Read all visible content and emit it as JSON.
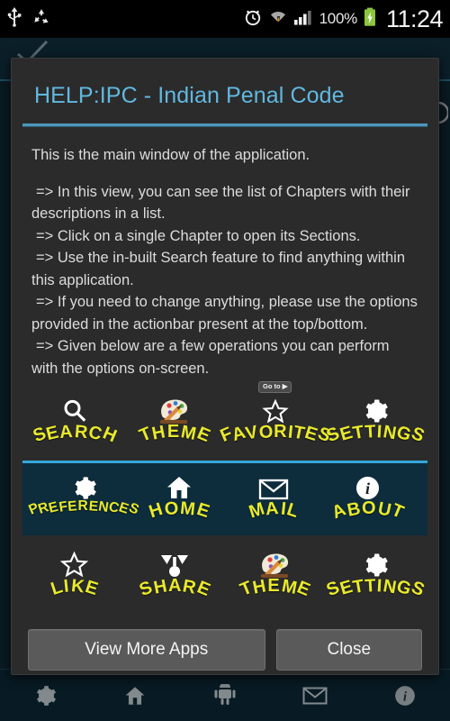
{
  "statusbar": {
    "icons": [
      "usb-icon",
      "recycle-icon",
      "alarm-clock-icon",
      "wifi-icon",
      "signal-bars-icon",
      "battery-charging-icon"
    ],
    "battery_percent": "100%",
    "clock": "11:24"
  },
  "dialog": {
    "title": "HELP:IPC - Indian Penal Code",
    "title_color": "#61b8e0",
    "divider_color": "#4d95ba",
    "intro": "This is the main window of the application.",
    "bullets": [
      "=> In this view, you can see the list of Chapters with their descriptions in a list.",
      "=> Click on a single Chapter to open its Sections.",
      "=> Use the in-built Search feature to find anything within this application.",
      "=> If you need to change anything, please use the options provided in the actionbar present at the top/bottom.",
      "=> Given below are a few operations you can perform with the options on-screen."
    ],
    "label_color": "#e9ea2b",
    "rows": [
      {
        "name": "top-actionbar-preview",
        "highlighted": false,
        "items": [
          {
            "label": "SEARCH",
            "icon": "search-icon",
            "badge": null
          },
          {
            "label": "THEME",
            "icon": "palette-icon",
            "badge": null
          },
          {
            "label": "FAVORITES",
            "icon": "star-outline-icon",
            "badge": "Go to ▶"
          },
          {
            "label": "SETTINGS",
            "icon": "gear-icon",
            "badge": null
          }
        ]
      },
      {
        "name": "bottom-actionbar-preview",
        "highlighted": true,
        "panel_bg": "#0d2c3c",
        "panel_border": "#34a6d9",
        "items": [
          {
            "label": "PREFERENCES",
            "icon": "gear-icon",
            "badge": null
          },
          {
            "label": "HOME",
            "icon": "home-icon",
            "badge": null
          },
          {
            "label": "MAIL",
            "icon": "envelope-icon",
            "badge": null
          },
          {
            "label": "ABOUT",
            "icon": "info-circle-icon",
            "badge": null
          }
        ]
      },
      {
        "name": "overflow-actions-preview",
        "highlighted": false,
        "items": [
          {
            "label": "LIKE",
            "icon": "star-outline-icon",
            "badge": null
          },
          {
            "label": "SHARE",
            "icon": "share-nodes-icon",
            "badge": null
          },
          {
            "label": "THEME",
            "icon": "palette-icon",
            "badge": null
          },
          {
            "label": "SETTINGS",
            "icon": "gear-icon",
            "badge": null
          }
        ]
      }
    ],
    "buttons": {
      "more_apps": "View More Apps",
      "close": "Close"
    }
  },
  "background_app": {
    "bottom_bar_icons": [
      "gear-icon",
      "home-icon",
      "android-share-icon",
      "envelope-icon",
      "info-circle-icon"
    ]
  }
}
